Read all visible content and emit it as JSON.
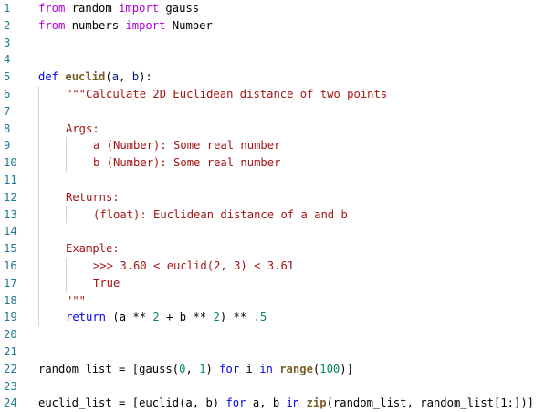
{
  "line_numbers": [
    "1",
    "2",
    "3",
    "4",
    "5",
    "6",
    "7",
    "8",
    "9",
    "10",
    "11",
    "12",
    "13",
    "14",
    "15",
    "16",
    "17",
    "18",
    "19",
    "20",
    "21",
    "22",
    "23",
    "24"
  ],
  "code": {
    "l1": {
      "from": "from",
      "mod": " random ",
      "import": "import",
      "name": " gauss"
    },
    "l2": {
      "from": "from",
      "mod": " numbers ",
      "import": "import",
      "name": " Number"
    },
    "l5": {
      "def": "def",
      "sp": " ",
      "fn": "euclid",
      "open": "(",
      "a": "a",
      "comma": ", ",
      "b": "b",
      "close": "):"
    },
    "l6": {
      "doc": "\"\"\"Calculate 2D Euclidean distance of two points"
    },
    "l8": {
      "doc": "Args:"
    },
    "l9": {
      "doc": "a (Number): Some real number"
    },
    "l10": {
      "doc": "b (Number): Some real number"
    },
    "l12": {
      "doc": "Returns:"
    },
    "l13": {
      "doc": "(float): Euclidean distance of a and b"
    },
    "l15": {
      "doc": "Example:"
    },
    "l16": {
      "doc": ">>> 3.60 < euclid(2, 3) < 3.61"
    },
    "l17": {
      "doc": "True"
    },
    "l18": {
      "doc": "\"\"\""
    },
    "l19": {
      "ret": "return",
      "p1": " (a ",
      "pow1": "**",
      "n2a": " 2",
      "p2": " + b ",
      "pow2": "**",
      "n2b": " 2",
      "p3": ") ",
      "pow3": "**",
      "n5": " .5"
    },
    "l22": {
      "var": "random_list",
      "eq": " = [gauss(",
      "n0": "0",
      "c": ", ",
      "n1": "1",
      "cl": ") ",
      "for": "for",
      "i": " i ",
      "in": "in",
      "sp": " ",
      "range": "range",
      "op": "(",
      "n100": "100",
      "end": ")]"
    },
    "l24": {
      "var": "euclid_list",
      "eq": " = [euclid(a, b) ",
      "for": "for",
      "ab": " a, b ",
      "in": "in",
      "sp": " ",
      "zip": "zip",
      "args": "(random_list, random_list[1:])]"
    }
  }
}
